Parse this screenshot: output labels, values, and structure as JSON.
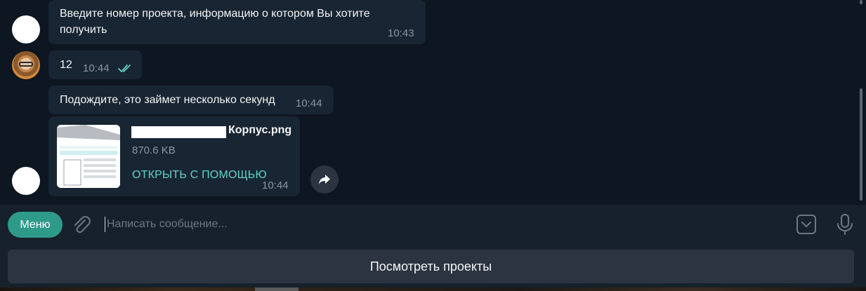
{
  "messages": [
    {
      "text_line1": "Введите номер проекта, информацию о котором Вы хотите",
      "text_line2": "получить",
      "time": "10:43"
    },
    {
      "text": "12",
      "time": "10:44"
    },
    {
      "text": "Подождите, это займет несколько секунд",
      "time": "10:44"
    }
  ],
  "file": {
    "name": "Корпус.png",
    "size": "870.6 KB",
    "open_label": "ОТКРЫТЬ С ПОМОЩЬЮ",
    "time": "10:44"
  },
  "input": {
    "menu_label": "Меню",
    "placeholder": "Написать сообщение..."
  },
  "keyboard": {
    "button_label": "Посмотреть проекты"
  },
  "colors": {
    "chat_background": "#0e1621",
    "bubble": "#182533",
    "accent": "#64d2c1",
    "menu_button": "#2e9a8a"
  },
  "icons": [
    "attach-icon",
    "emoji-keyboard-icon",
    "mic-icon",
    "forward-icon",
    "double-check-icon"
  ]
}
